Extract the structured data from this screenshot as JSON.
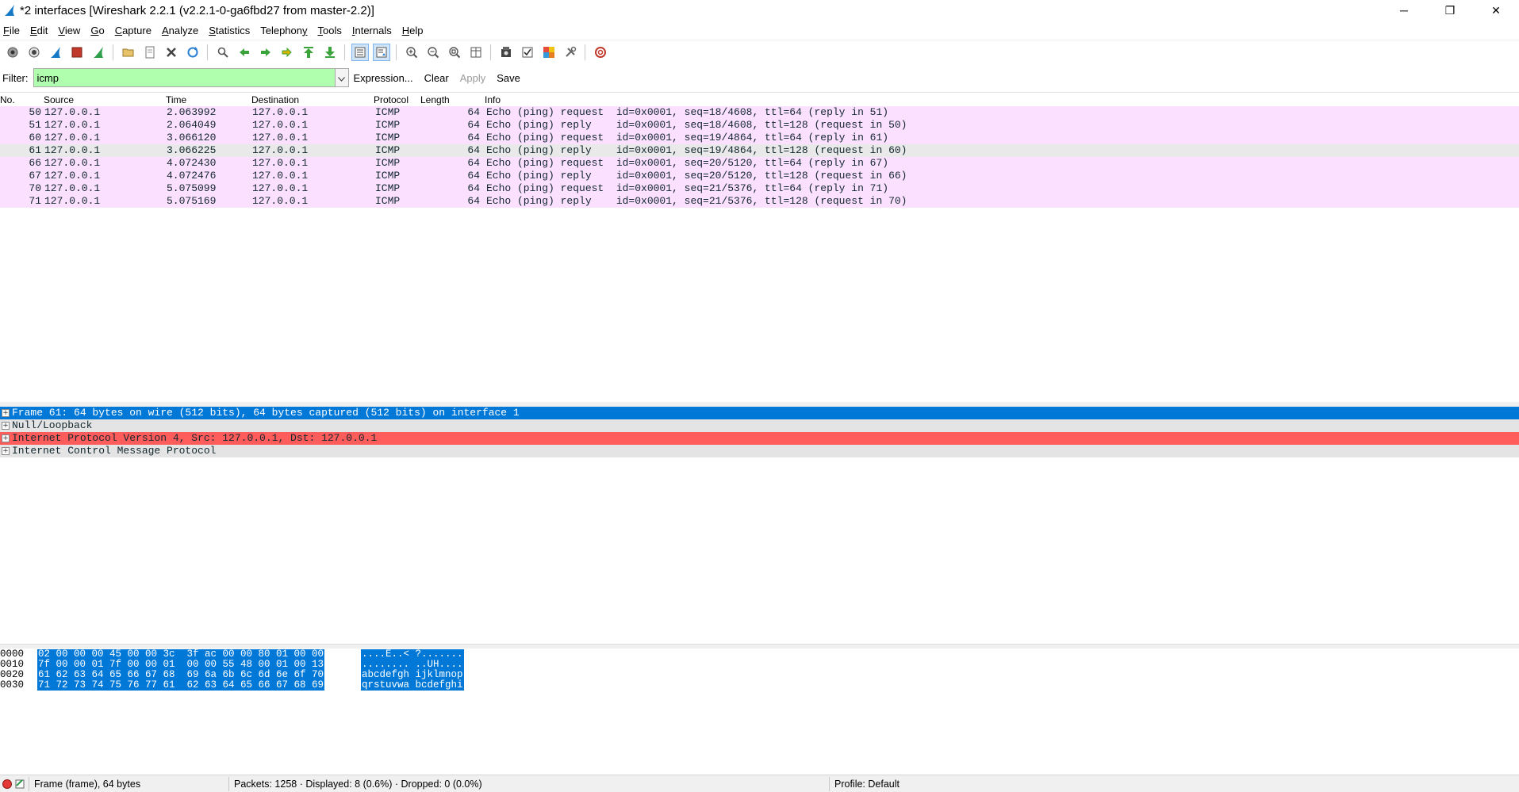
{
  "window": {
    "title": "*2 interfaces [Wireshark 2.2.1 (v2.2.1-0-ga6fbd27 from master-2.2)]",
    "minimize": "─",
    "restore": "❐",
    "close": "✕"
  },
  "menu": {
    "items": [
      {
        "label": "File",
        "ul": "F",
        "rest": "ile"
      },
      {
        "label": "Edit",
        "ul": "E",
        "rest": "dit"
      },
      {
        "label": "View",
        "ul": "V",
        "rest": "iew"
      },
      {
        "label": "Go",
        "ul": "G",
        "rest": "o"
      },
      {
        "label": "Capture",
        "ul": "C",
        "rest": "apture"
      },
      {
        "label": "Analyze",
        "ul": "A",
        "rest": "nalyze"
      },
      {
        "label": "Statistics",
        "ul": "S",
        "rest": "tatistics"
      },
      {
        "label": "Telephony",
        "ul": "y",
        "pre": "Telephon"
      },
      {
        "label": "Tools",
        "ul": "T",
        "rest": "ools"
      },
      {
        "label": "Internals",
        "ul": "I",
        "rest": "nternals"
      },
      {
        "label": "Help",
        "ul": "H",
        "rest": "elp"
      }
    ]
  },
  "filter": {
    "label": "Filter:",
    "value": "icmp",
    "expression": "Expression...",
    "clear": "Clear",
    "apply": "Apply",
    "save": "Save"
  },
  "packet_list": {
    "columns": [
      "No.",
      "Source",
      "Time",
      "Destination",
      "Protocol",
      "Length",
      "Info"
    ],
    "rows": [
      {
        "no": "50",
        "src": "127.0.0.1",
        "time": "2.063992",
        "dst": "127.0.0.1",
        "proto": "ICMP",
        "len": "64",
        "info": "Echo (ping) request  id=0x0001, seq=18/4608, ttl=64 (reply in 51)"
      },
      {
        "no": "51",
        "src": "127.0.0.1",
        "time": "2.064049",
        "dst": "127.0.0.1",
        "proto": "ICMP",
        "len": "64",
        "info": "Echo (ping) reply    id=0x0001, seq=18/4608, ttl=128 (request in 50)"
      },
      {
        "no": "60",
        "src": "127.0.0.1",
        "time": "3.066120",
        "dst": "127.0.0.1",
        "proto": "ICMP",
        "len": "64",
        "info": "Echo (ping) request  id=0x0001, seq=19/4864, ttl=64 (reply in 61)"
      },
      {
        "no": "61",
        "src": "127.0.0.1",
        "time": "3.066225",
        "dst": "127.0.0.1",
        "proto": "ICMP",
        "len": "64",
        "info": "Echo (ping) reply    id=0x0001, seq=19/4864, ttl=128 (request in 60)"
      },
      {
        "no": "66",
        "src": "127.0.0.1",
        "time": "4.072430",
        "dst": "127.0.0.1",
        "proto": "ICMP",
        "len": "64",
        "info": "Echo (ping) request  id=0x0001, seq=20/5120, ttl=64 (reply in 67)"
      },
      {
        "no": "67",
        "src": "127.0.0.1",
        "time": "4.072476",
        "dst": "127.0.0.1",
        "proto": "ICMP",
        "len": "64",
        "info": "Echo (ping) reply    id=0x0001, seq=20/5120, ttl=128 (request in 66)"
      },
      {
        "no": "70",
        "src": "127.0.0.1",
        "time": "5.075099",
        "dst": "127.0.0.1",
        "proto": "ICMP",
        "len": "64",
        "info": "Echo (ping) request  id=0x0001, seq=21/5376, ttl=64 (reply in 71)"
      },
      {
        "no": "71",
        "src": "127.0.0.1",
        "time": "5.075169",
        "dst": "127.0.0.1",
        "proto": "ICMP",
        "len": "64",
        "info": "Echo (ping) reply    id=0x0001, seq=21/5376, ttl=128 (request in 70)"
      }
    ],
    "row_color": "#fce0ff",
    "selected_row_no": "61"
  },
  "details": {
    "rows": [
      {
        "text": "Frame 61: 64 bytes on wire (512 bits), 64 bytes captured (512 bits) on interface 1",
        "style": "sel"
      },
      {
        "text": "Null/Loopback",
        "style": "gray"
      },
      {
        "text": "Internet Protocol Version 4, Src: 127.0.0.1, Dst: 127.0.0.1",
        "style": "red"
      },
      {
        "text": "Internet Control Message Protocol",
        "style": "gray"
      }
    ],
    "expander": "+"
  },
  "bytes": {
    "rows": [
      {
        "offset": "0000",
        "hex": "02 00 00 00 45 00 00 3c  3f ac 00 00 80 01 00 00",
        "ascii": "....E..< ?......."
      },
      {
        "offset": "0010",
        "hex": "7f 00 00 01 7f 00 00 01  00 00 55 48 00 01 00 13",
        "ascii": "........ ..UH...."
      },
      {
        "offset": "0020",
        "hex": "61 62 63 64 65 66 67 68  69 6a 6b 6c 6d 6e 6f 70",
        "ascii": "abcdefgh ijklmnop"
      },
      {
        "offset": "0030",
        "hex": "71 72 73 74 75 76 77 61  62 63 64 65 66 67 68 69",
        "ascii": "qrstuvwa bcdefghi"
      }
    ]
  },
  "status": {
    "frame": "Frame (frame), 64 bytes",
    "packets": "Packets: 1258 · Displayed: 8 (0.6%) · Dropped: 0 (0.0%)",
    "profile": "Profile: Default"
  },
  "colors": {
    "selection_blue": "#0078d7",
    "filter_green": "#afffaf",
    "ip_red": "#ff5c5c",
    "icmp_pink": "#fce0ff"
  }
}
